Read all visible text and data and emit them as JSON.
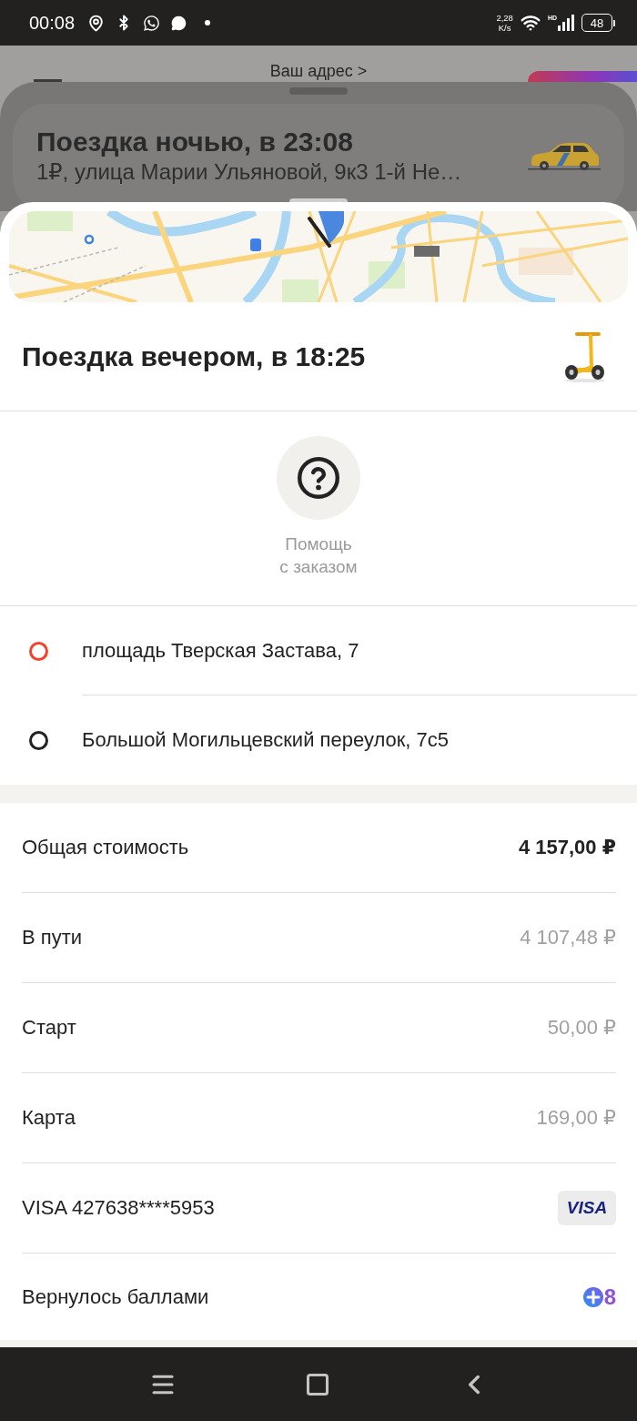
{
  "status_bar": {
    "time": "00:08",
    "speed_value": "2,28",
    "speed_unit": "K/s",
    "network": "HD",
    "battery": "48"
  },
  "background": {
    "address_link": "Ваш адрес >"
  },
  "previous_order": {
    "title": "Поездка ночью, в 23:08",
    "subtitle": "1₽, улица Марии Ульяновой, 9к3 1-й Не…"
  },
  "order": {
    "title": "Поездка вечером, в 18:25",
    "help_label": "Помощь\nс заказом"
  },
  "route": [
    {
      "address": "площадь Тверская Застава, 7",
      "color": "#f5412d"
    },
    {
      "address": "Большой Могильцевский переулок, 7с5",
      "color": "#222222"
    }
  ],
  "costs": [
    {
      "kind": "total",
      "label": "Общая стоимость",
      "value": "4 157,00 ₽"
    },
    {
      "kind": "charge",
      "label": "В пути",
      "value": "4 107,48 ₽"
    },
    {
      "kind": "charge",
      "label": "Старт",
      "value": "50,00 ₽"
    },
    {
      "kind": "charge",
      "label": "Карта",
      "value": "169,00 ₽"
    },
    {
      "kind": "card",
      "label": "VISA 427638****5953",
      "value": "VISA"
    },
    {
      "kind": "points",
      "label": "Вернулось баллами",
      "value": "8"
    }
  ]
}
